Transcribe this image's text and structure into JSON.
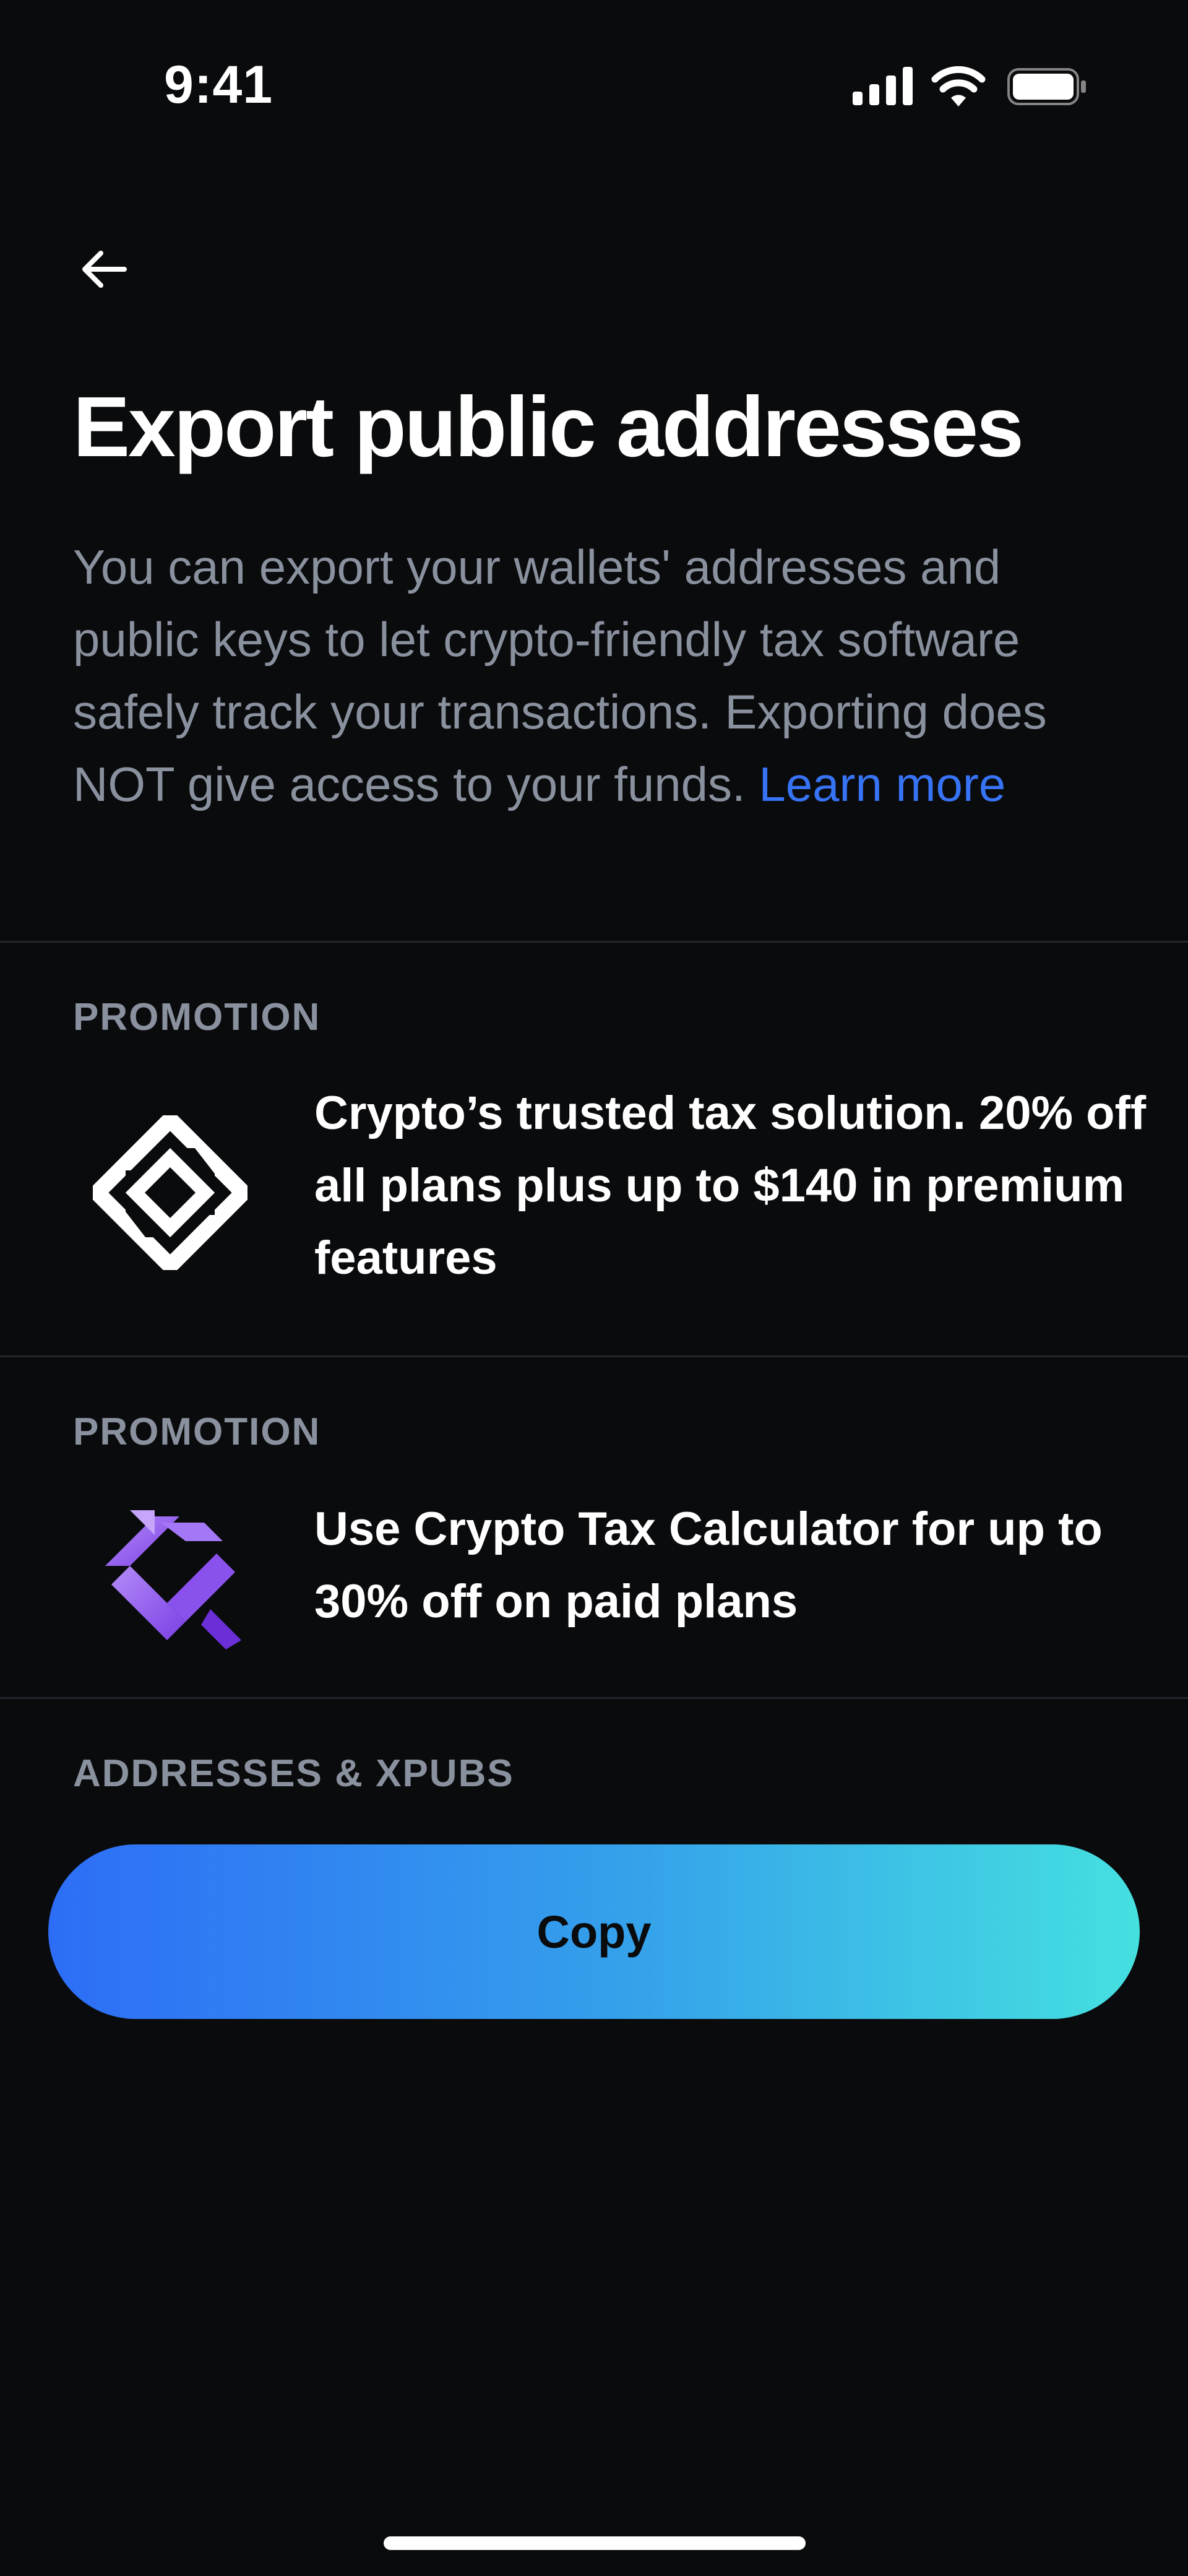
{
  "status_bar": {
    "time": "9:41",
    "icons": [
      "cellular-signal-icon",
      "wifi-icon",
      "battery-icon"
    ]
  },
  "header": {
    "back_icon": "arrow-left-icon",
    "title": "Export public addresses"
  },
  "description": {
    "text": "You can export your wallets' addresses and public keys to let crypto-friendly tax software safely track your transactions. Exporting does NOT give access to your funds.",
    "link_label": "Learn more"
  },
  "promotions": [
    {
      "section_label": "PROMOTION",
      "logo_icon": "tax-solution-logo-icon",
      "text": "Crypto’s trusted tax solution. 20% off all plans plus up to $140 in premium features"
    },
    {
      "section_label": "PROMOTION",
      "logo_icon": "crypto-tax-calculator-logo-icon",
      "text": "Use Crypto Tax Calculator for up to 30% off on paid plans"
    }
  ],
  "addresses": {
    "section_label": "ADDRESSES & XPUBS",
    "copy_button_label": "Copy"
  },
  "colors": {
    "background": "#0a0b0d",
    "secondary_text": "#8a919e",
    "link": "#3773f5",
    "button_gradient_start": "#2d6df6",
    "button_gradient_end": "#45e0e0"
  }
}
